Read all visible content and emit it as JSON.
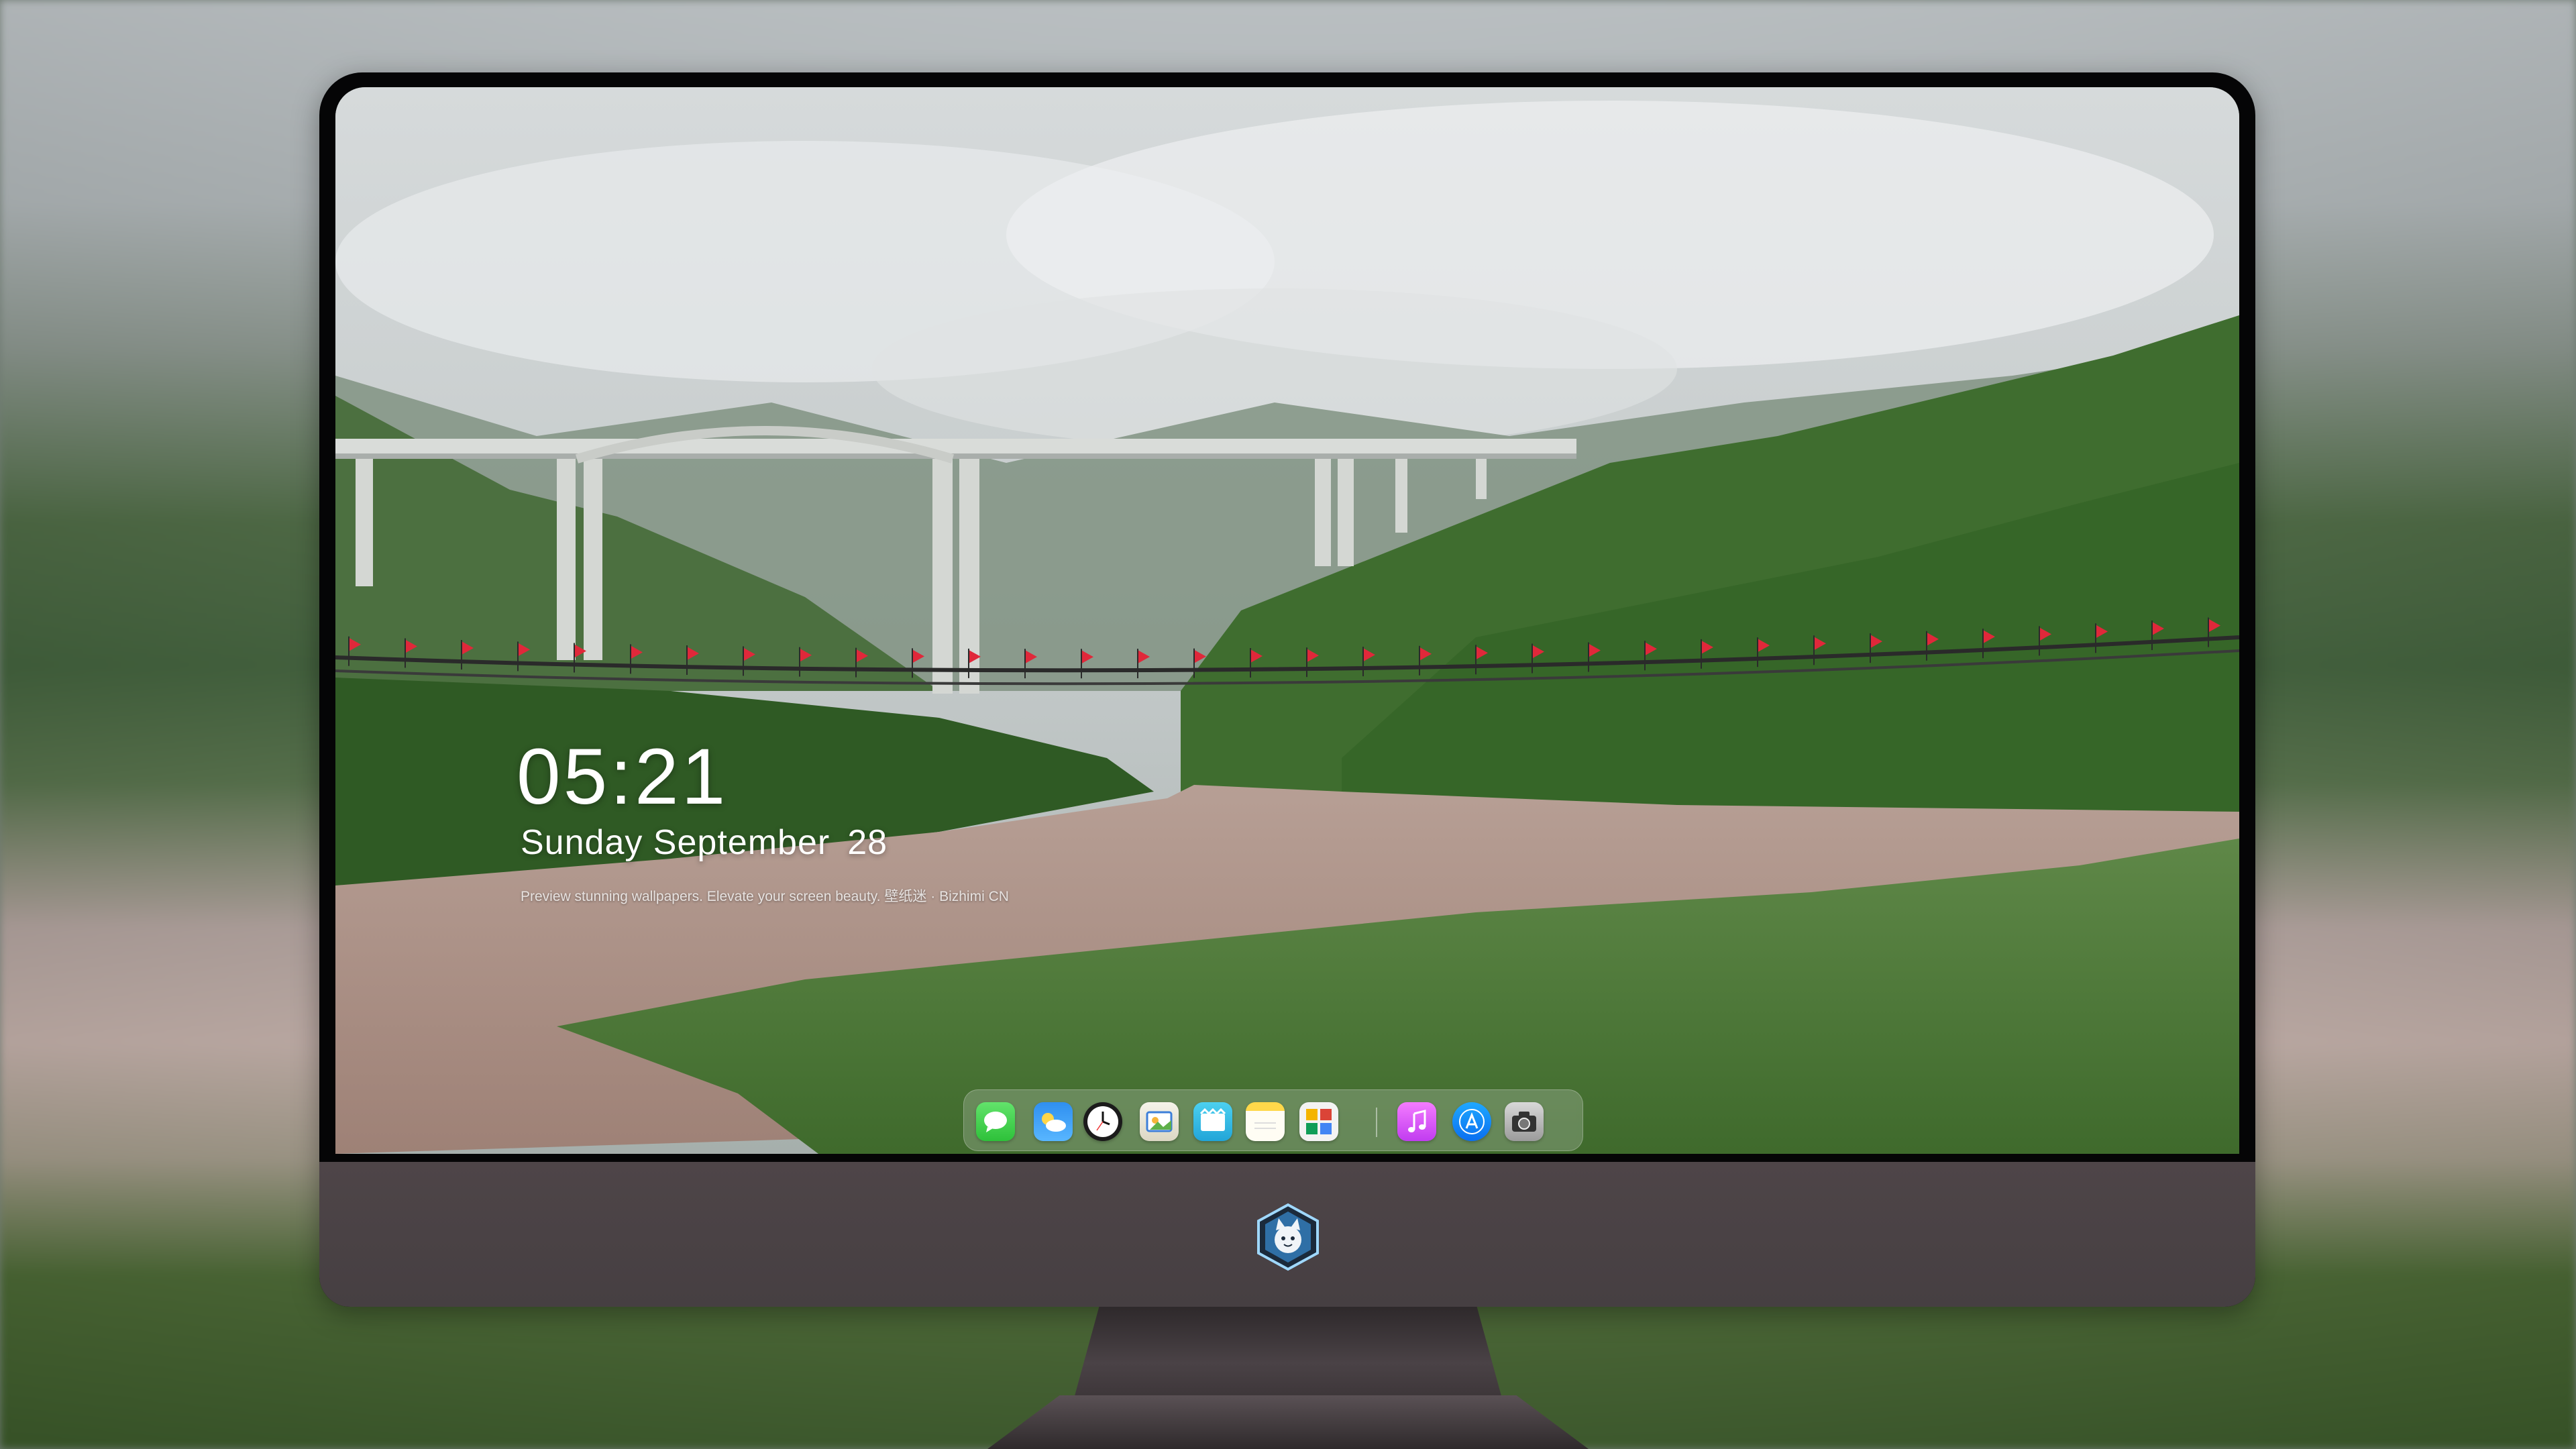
{
  "lockscreen": {
    "time": "05:21",
    "weekday_month": "Sunday September",
    "day": "28",
    "tagline": "Preview stunning wallpapers. Elevate your screen beauty. 壁纸迷 · Bizhimi CN"
  },
  "dock": {
    "apps": [
      {
        "name": "Messages",
        "icon": "messages-icon"
      },
      {
        "name": "Weather",
        "icon": "weather-icon"
      },
      {
        "name": "Clock",
        "icon": "clock-icon"
      },
      {
        "name": "Preview",
        "icon": "preview-icon"
      },
      {
        "name": "Clips",
        "icon": "clips-icon"
      },
      {
        "name": "Notes",
        "icon": "notes-icon"
      },
      {
        "name": "Photos",
        "icon": "photos-icon"
      },
      {
        "name": "Music",
        "icon": "music-icon"
      },
      {
        "name": "App Store",
        "icon": "app-store-icon"
      },
      {
        "name": "Camera",
        "icon": "camera-icon"
      }
    ]
  },
  "wallpaper": {
    "subject": "river with suspension bridge with red flags, highway viaduct and misty green mountains"
  },
  "colors": {
    "bezel": "#050506",
    "chin": "#4a4245",
    "clock_text": "#ffffff",
    "flag_red": "#e0283a"
  }
}
